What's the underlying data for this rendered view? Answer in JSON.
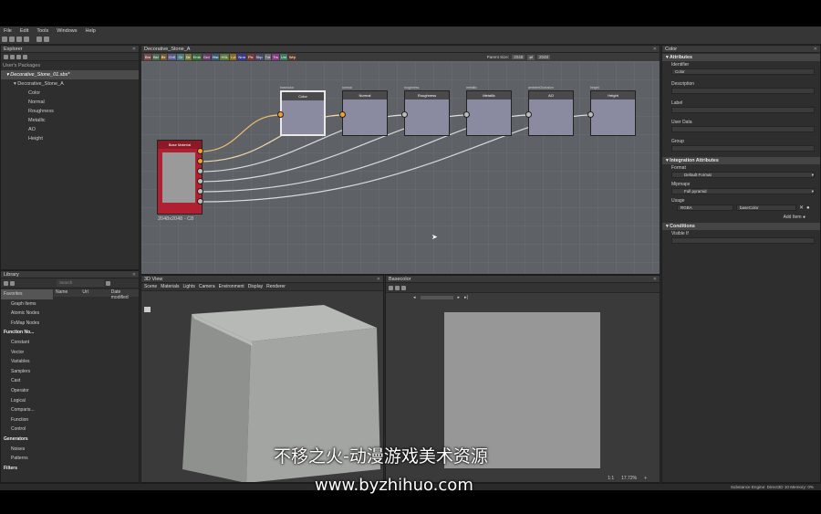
{
  "menu": [
    "File",
    "Edit",
    "Tools",
    "Windows",
    "Help"
  ],
  "explorer": {
    "title": "Explorer",
    "section": "User's Packages",
    "package": "Decorative_Stone_01.sbs*",
    "graph": "Decorative_Stone_A",
    "outputs": [
      "Color",
      "Normal",
      "Roughness",
      "Metallic",
      "AO",
      "Height"
    ]
  },
  "graph_tab": {
    "title": "Decorative_Stone_A",
    "chips": [
      "Bm",
      "Bld",
      "Blr",
      "ChS",
      "Clr",
      "Dir",
      "Emb",
      "Grd",
      "Hist",
      "HSL",
      "Lvl",
      "Nrm",
      "Pix",
      "Shp",
      "Txt",
      "Trs",
      "Uni",
      "Wrp"
    ],
    "chip_colors": [
      "#7a4a4a",
      "#4a6a4a",
      "#7a5a2a",
      "#5a5a8a",
      "#4a7a7a",
      "#7a7a3a",
      "#3a6a3a",
      "#6a3a6a",
      "#3a5a7a",
      "#5a7a3a",
      "#8a6a2a",
      "#3a3a8a",
      "#7a3a3a",
      "#4a4a6a",
      "#6a6a6a",
      "#8a3a8a",
      "#3a7a5a",
      "#5a3a2a"
    ],
    "parent_size_label": "Parent Size:",
    "parent_size_a": "2048",
    "parent_size_b": "2048"
  },
  "nodes": {
    "source_title": "Base Material",
    "source_size": "2048x2048 - C8",
    "outputs": [
      {
        "title": "Color",
        "caption": "basecolor",
        "color": "#f0a030"
      },
      {
        "title": "Normal",
        "caption": "normal",
        "color": "#f0a030"
      },
      {
        "title": "Roughness",
        "caption": "roughness",
        "color": "#bcbcbc"
      },
      {
        "title": "Metallic",
        "caption": "metallic",
        "color": "#bcbcbc"
      },
      {
        "title": "AO",
        "caption": "ambientOcclusion",
        "color": "#bcbcbc"
      },
      {
        "title": "Height",
        "caption": "height",
        "color": "#bcbcbc"
      }
    ]
  },
  "library": {
    "title": "Library",
    "search_placeholder": "Search",
    "columns": [
      "Name",
      "Url",
      "Date modified"
    ],
    "items": [
      {
        "label": "Favorites",
        "kind": "fav"
      },
      {
        "label": "Graph Items",
        "kind": "item"
      },
      {
        "label": "Atomic Nodes",
        "kind": "item"
      },
      {
        "label": "FxMap Nodes",
        "kind": "item"
      },
      {
        "label": "Function No...",
        "kind": "hdr"
      },
      {
        "label": "Constant",
        "kind": "item"
      },
      {
        "label": "Vector",
        "kind": "item"
      },
      {
        "label": "Variables",
        "kind": "item"
      },
      {
        "label": "Samplers",
        "kind": "item"
      },
      {
        "label": "Cast",
        "kind": "item"
      },
      {
        "label": "Operator",
        "kind": "item"
      },
      {
        "label": "Logical",
        "kind": "item"
      },
      {
        "label": "Comparis...",
        "kind": "item"
      },
      {
        "label": "Function",
        "kind": "item"
      },
      {
        "label": "Control",
        "kind": "item"
      },
      {
        "label": "Generators",
        "kind": "hdr"
      },
      {
        "label": "Noises",
        "kind": "item"
      },
      {
        "label": "Patterns",
        "kind": "item"
      },
      {
        "label": "Filters",
        "kind": "hdr"
      }
    ]
  },
  "view3d": {
    "title": "3D View",
    "menu": [
      "Scene",
      "Materials",
      "Lights",
      "Camera",
      "Environment",
      "Display",
      "Renderer"
    ]
  },
  "view2d": {
    "title": "Basecolor",
    "zoom": "17.72%",
    "ratio": "1:1"
  },
  "properties": {
    "title": "Color",
    "sections": {
      "attributes": "Attributes",
      "integration": "Integration Attributes",
      "conditions": "Conditions"
    },
    "identifier_label": "Identifier",
    "identifier_value": "Color",
    "description_label": "Description",
    "label_label": "Label",
    "userdata_label": "User Data",
    "group_label": "Group",
    "format_label": "Format",
    "format_value": "Default Format",
    "mipmaps_label": "Mipmaps",
    "mipmaps_value": "Full pyramid",
    "usage_label": "Usage",
    "usage_channel": "RGBA",
    "usage_value": "baseColor",
    "add_item": "Add Item",
    "visible_if": "Visible If"
  },
  "status": "Substance Engine: Direct3D 10  Memory: 0%",
  "watermark": {
    "title": "不移之火-动漫游戏美术资源",
    "url": "www.byzhihuo.com"
  }
}
